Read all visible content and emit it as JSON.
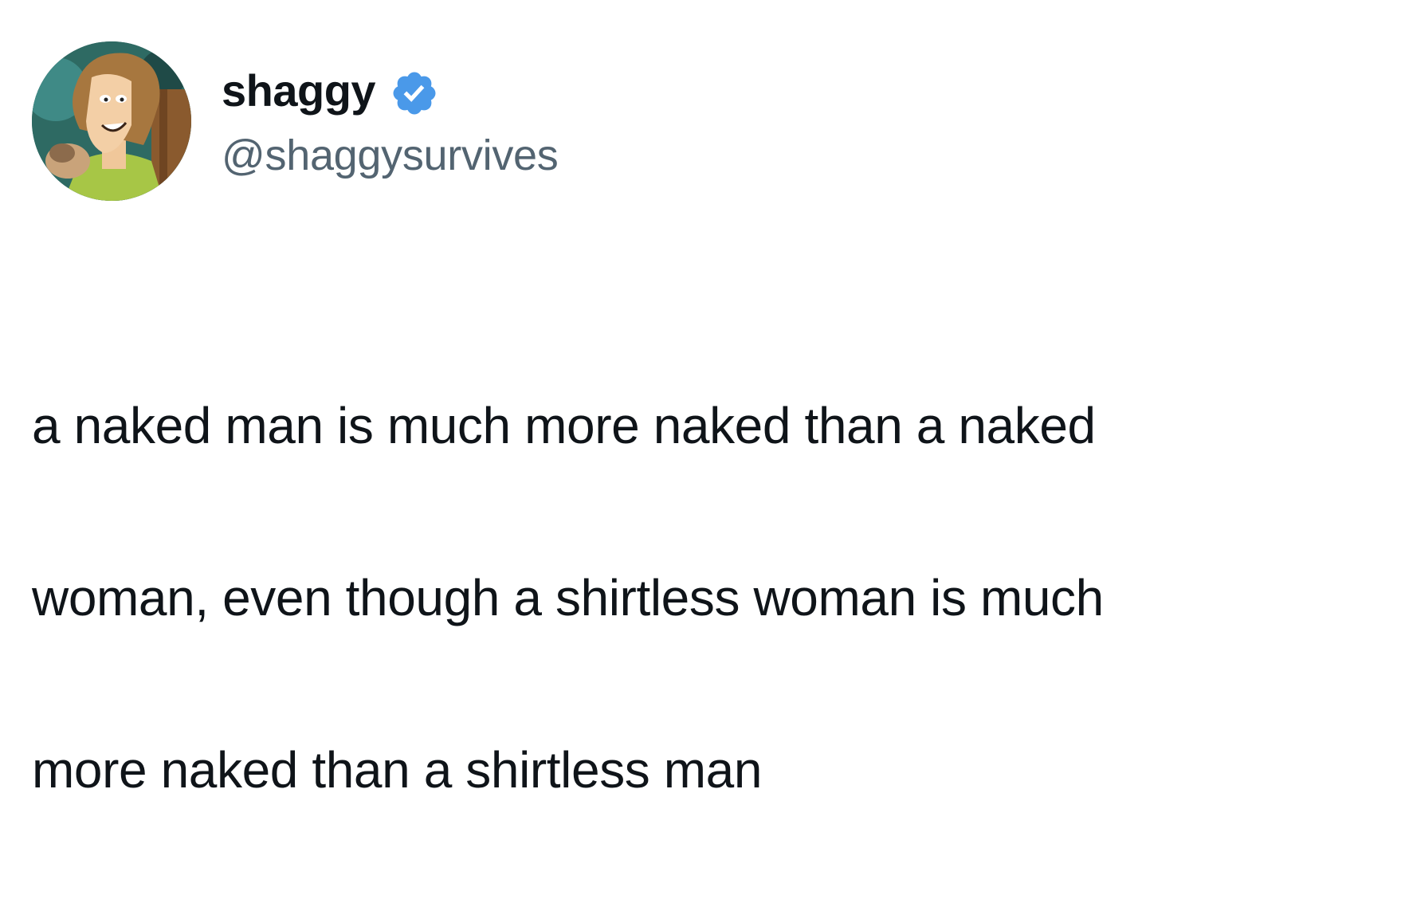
{
  "tweet": {
    "author": {
      "display_name": "shaggy",
      "handle": "@shaggysurvives",
      "verified": true,
      "verified_color": "#4a99e9"
    },
    "text_lines": [
      "a naked man is much more naked than a naked",
      "woman, even though a shirtless woman is much",
      "more naked than a shirtless man"
    ]
  },
  "colors": {
    "background": "#ffffff",
    "text_primary": "#0f1419",
    "text_secondary": "#536471"
  },
  "icons": {
    "avatar": "avatar-image",
    "verified": "verified-badge-icon"
  }
}
